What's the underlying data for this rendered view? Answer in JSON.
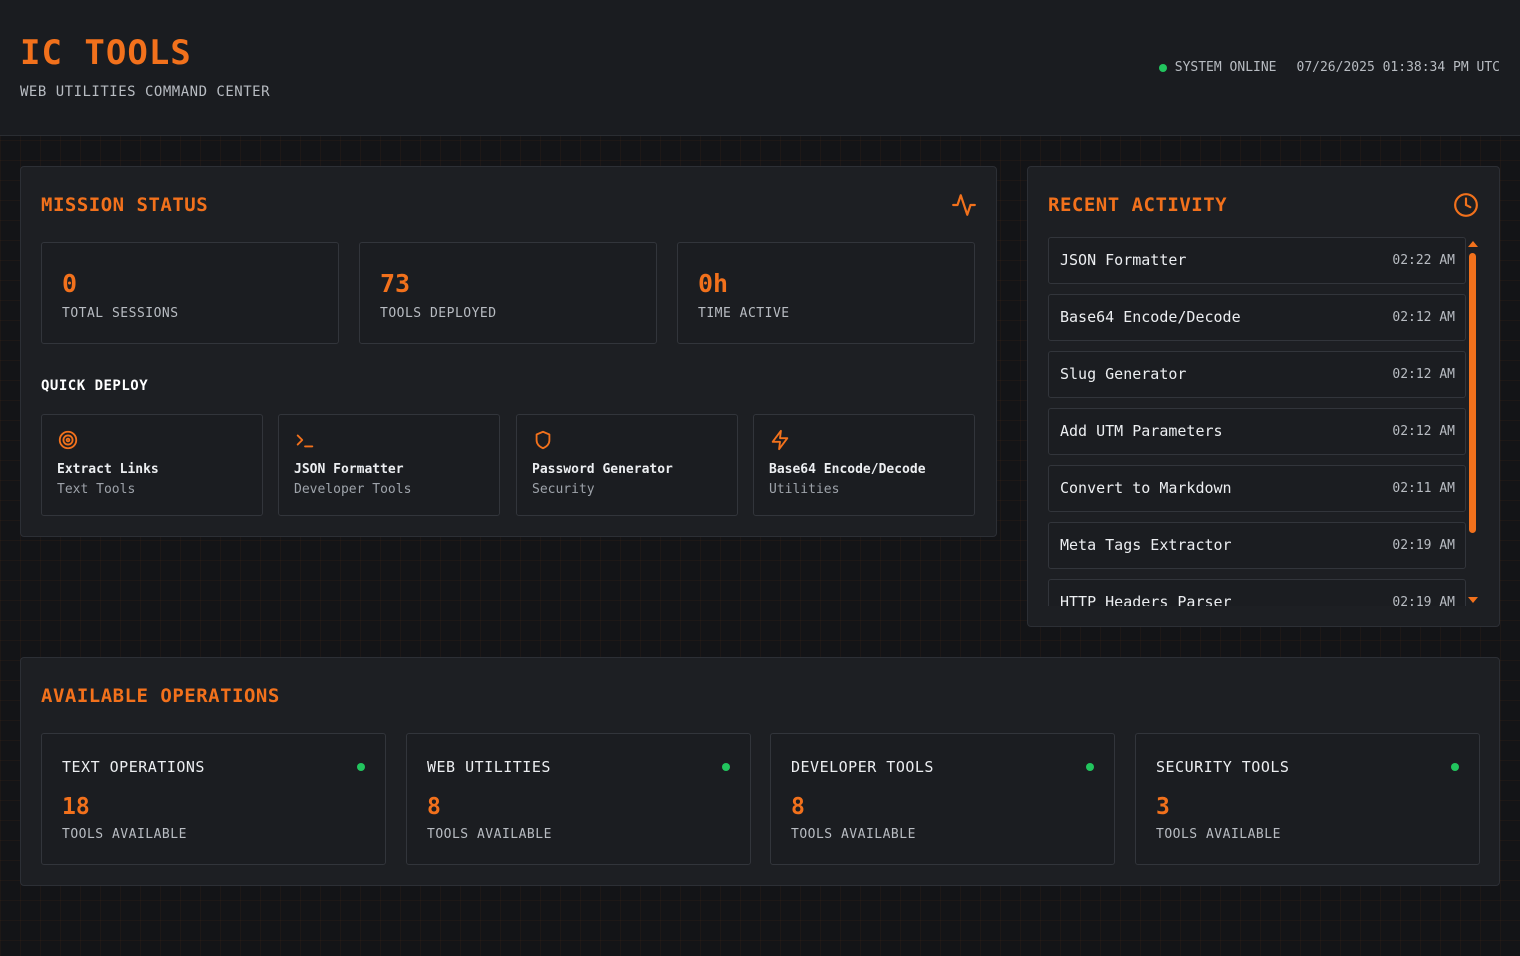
{
  "app": {
    "title": "IC TOOLS",
    "subtitle": "WEB UTILITIES COMMAND CENTER",
    "status_text": "SYSTEM ONLINE",
    "datetime": "07/26/2025 01:38:34 PM UTC"
  },
  "colors": {
    "accent": "#f2711c",
    "online": "#22c55e",
    "background": "#131417",
    "panel": "#1d1f23"
  },
  "mission": {
    "title": "MISSION STATUS",
    "icon": "activity-pulse-icon",
    "stats": [
      {
        "value": "0",
        "label": "TOTAL SESSIONS"
      },
      {
        "value": "73",
        "label": "TOOLS DEPLOYED"
      },
      {
        "value": "0h",
        "label": "TIME ACTIVE"
      }
    ],
    "quick_deploy_title": "QUICK DEPLOY",
    "quick_deploy": [
      {
        "name": "Extract Links",
        "category": "Text Tools",
        "icon": "target-icon"
      },
      {
        "name": "JSON Formatter",
        "category": "Developer Tools",
        "icon": "terminal-icon"
      },
      {
        "name": "Password Generator",
        "category": "Security",
        "icon": "shield-icon"
      },
      {
        "name": "Base64 Encode/Decode",
        "category": "Utilities",
        "icon": "lightning-icon"
      }
    ]
  },
  "activity": {
    "title": "RECENT ACTIVITY",
    "icon": "clock-icon",
    "items": [
      {
        "name": "JSON Formatter",
        "time": "02:22 AM"
      },
      {
        "name": "Base64 Encode/Decode",
        "time": "02:12 AM"
      },
      {
        "name": "Slug Generator",
        "time": "02:12 AM"
      },
      {
        "name": "Add UTM Parameters",
        "time": "02:12 AM"
      },
      {
        "name": "Convert to Markdown",
        "time": "02:11 AM"
      },
      {
        "name": "Meta Tags Extractor",
        "time": "02:19 AM"
      },
      {
        "name": "HTTP Headers Parser",
        "time": "02:19 AM"
      }
    ]
  },
  "operations": {
    "title": "AVAILABLE OPERATIONS",
    "categories": [
      {
        "name": "TEXT OPERATIONS",
        "count": "18",
        "label": "TOOLS AVAILABLE"
      },
      {
        "name": "WEB UTILITIES",
        "count": "8",
        "label": "TOOLS AVAILABLE"
      },
      {
        "name": "DEVELOPER TOOLS",
        "count": "8",
        "label": "TOOLS AVAILABLE"
      },
      {
        "name": "SECURITY TOOLS",
        "count": "3",
        "label": "TOOLS AVAILABLE"
      }
    ]
  }
}
